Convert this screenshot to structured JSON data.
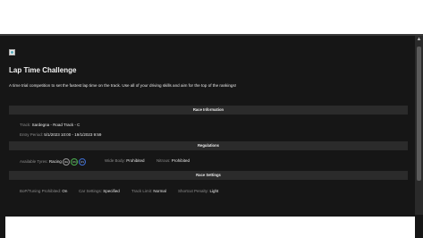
{
  "page": {
    "title": "Lap Time Challenge",
    "description": "A time trial competition to set the fastest lap time on the track. Use all of your driving skills and aim for the top of the rankings!"
  },
  "race_information": {
    "header": "Race Information",
    "track_label": "Track:",
    "track_value": "Sardegna - Road Track - C",
    "entry_label": "Entry Period:",
    "entry_value": "5/1/2023 10:00 - 19/1/2023 9:59"
  },
  "regulations": {
    "header": "Regulations",
    "tyres_label": "Available Tyres:",
    "tyres_value": "Racing",
    "tyre_pills": [
      "RH",
      "RM",
      "RS"
    ],
    "widebody_label": "Wide Body:",
    "widebody_value": "Prohibited",
    "nitrous_label": "Nitrous:",
    "nitrous_value": "Prohibited"
  },
  "race_settings": {
    "header": "Race Settings",
    "bop_label": "BoP/Tuning Prohibited:",
    "bop_value": "On",
    "car_settings_label": "Car Settings:",
    "car_settings_value": "Specified",
    "track_limit_label": "Track Limit:",
    "track_limit_value": "Normal",
    "shortcut_label": "Shortcut Penalty:",
    "shortcut_value": "Light"
  },
  "icons": {
    "image": "broken-image-icon"
  }
}
